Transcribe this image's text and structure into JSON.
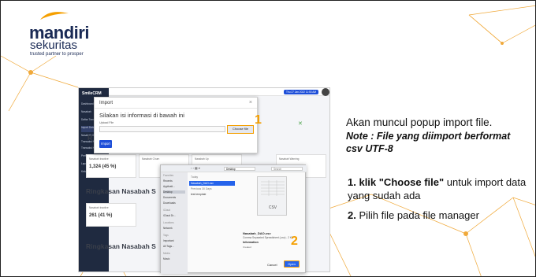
{
  "brand": {
    "name": "mandiri",
    "sub": "sekuritas",
    "tagline": "trusted partner to prosper"
  },
  "colors": {
    "accent": "#f59f00",
    "navy": "#1a2a55",
    "primary_blue": "#1d4ed8"
  },
  "app": {
    "name": "SmileCRM",
    "date": "Thu 27 Jan 2022 11:53 AM",
    "sidebar": [
      "Dashboard",
      "Nasabah",
      "Daftar Transaksi",
      "Import Data",
      "Nasabah Only",
      "Transaksi Nasabah",
      "Transaksi Harian",
      "Performance Pendaftaran",
      "Laporan",
      "Keluar"
    ],
    "section1": "Ringkasan Nasabah S",
    "section2": "Ringkasan Nasabah S",
    "section3": "Ringkasan Nasabah S",
    "cards": [
      {
        "label": "Nasabah Inactive",
        "value": "1,324 (45 %)"
      },
      {
        "label": "Nasabah Churn",
        "value": ""
      },
      {
        "label": "Nasabah Up",
        "value": ""
      },
      {
        "label": "Nasabah Warning",
        "value": ""
      }
    ],
    "card2": {
      "label": "Nasabah Inactive",
      "value": "261 (41 %)"
    }
  },
  "modal": {
    "title": "Import",
    "close": "×",
    "heading": "Silakan isi informasi di bawah ini",
    "file_label": "Upload File",
    "choose_label": "Choose file",
    "import_label": "Import",
    "step": "1"
  },
  "file_manager": {
    "location": "Desktop",
    "search": "Search",
    "sidebar": [
      {
        "label": "Favorites",
        "header": true
      },
      {
        "label": "Recents"
      },
      {
        "label": "Applicati..."
      },
      {
        "label": "Desktop",
        "selected": true
      },
      {
        "label": "Documents"
      },
      {
        "label": "Downloads"
      },
      {
        "label": "iCloud",
        "header": true
      },
      {
        "label": "iCloud Dr..."
      },
      {
        "label": "Locations",
        "header": true
      },
      {
        "label": "Network"
      },
      {
        "label": "Tags",
        "header": true
      },
      {
        "label": "Important"
      },
      {
        "label": "All Tags..."
      },
      {
        "label": "Media",
        "header": true
      },
      {
        "label": "Music"
      }
    ],
    "list_header": "Today",
    "files": [
      {
        "name": "Nasabah_DAO.csv",
        "selected": true
      },
      {
        "name": "Previous 30 Days",
        "header": true
      },
      {
        "name": "test template"
      }
    ],
    "preview_ext": "CSV",
    "file_name": "Nasabah_DAO.csv",
    "file_desc": "Comma Separated Spreadsheet (.csv) - 2 KB",
    "info_label": "Information",
    "created": "Created",
    "cancel_label": "Cancel",
    "open_label": "Open",
    "step": "2"
  },
  "instructions": {
    "intro": "Akan muncul popup import file.",
    "note": "Note : File yang diimport berformat csv UTF-8",
    "step1_num": "1.",
    "step1_pre": "klik ",
    "step1_strong": "\"Choose file\"",
    "step1_post": " untuk import data yang sudah ada",
    "step2_num": "2.",
    "step2_text": "Pilih file pada file manager"
  }
}
